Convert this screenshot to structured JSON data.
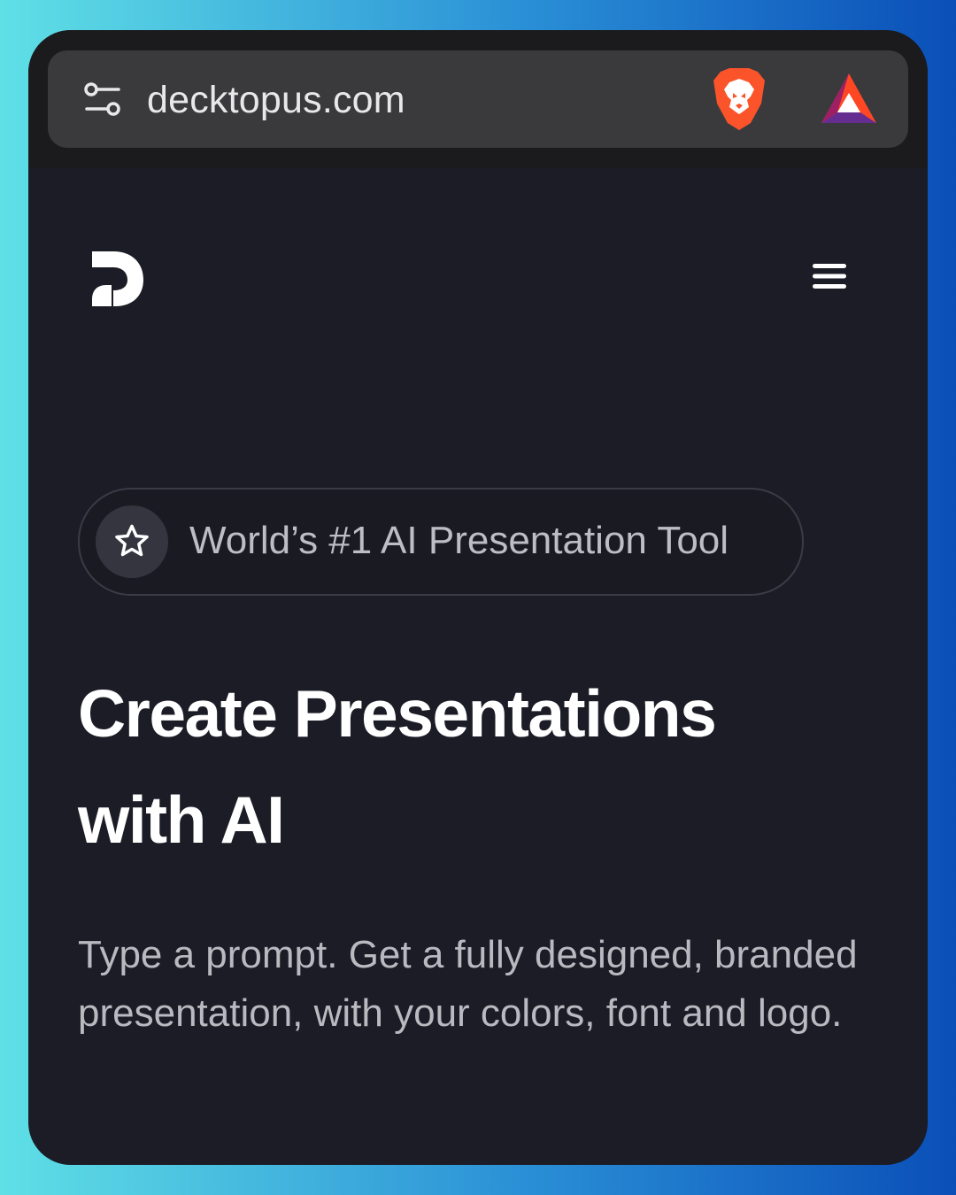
{
  "browser": {
    "url": "decktopus.com",
    "icons": [
      "tune-icon",
      "brave-lion-icon",
      "bat-triangle-icon"
    ]
  },
  "header": {
    "logo_icon": "decktopus-logo",
    "menu_icon": "hamburger-menu-icon"
  },
  "hero": {
    "badge_icon": "star-icon",
    "badge_text": "World’s #1 AI Presentation Tool",
    "headline_line1": "Create Presentations",
    "headline_line2": "with AI",
    "subheadline": "Type a prompt. Get a fully designed, branded presentation, with your colors, font and logo."
  },
  "colors": {
    "page_bg": "#1b1c25",
    "brave_orange": "#fb542b",
    "bat_purple": "#662d91",
    "bat_red": "#ff4724"
  }
}
